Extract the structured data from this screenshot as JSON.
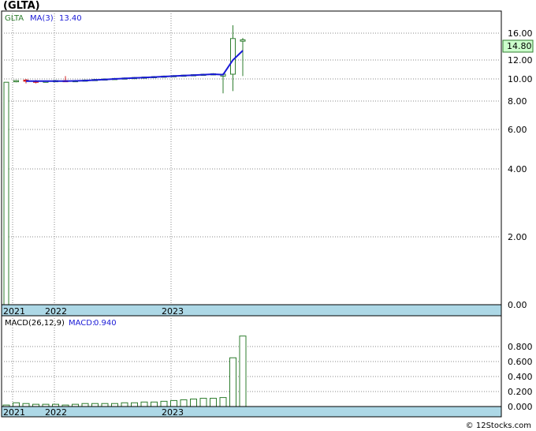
{
  "title": "(GLTA)",
  "footer": "© 12Stocks.com",
  "colors": {
    "up_candle": "#2e7d2e",
    "down_candle": "#d62020",
    "ma_line": "#1a1ad6",
    "date_band": "#add8e6",
    "grid": "#888888",
    "ticker_green": "#2e7d2e",
    "macd_blue": "#1a1ad6"
  },
  "chart_data": [
    {
      "type": "candlestick",
      "ticker_label": "GLTA",
      "ma_label": "MA(3)",
      "ma_value": "13.40",
      "last_price": "14.80",
      "scale": "log",
      "ylim": [
        0,
        18
      ],
      "y_ticks": [
        "16.00",
        "12.00",
        "10.00",
        "8.00",
        "6.00",
        "4.00",
        "2.00",
        "0.00"
      ],
      "y_tick_values": [
        16,
        12,
        10,
        8,
        6,
        4,
        2,
        0
      ],
      "x_ticks": [
        "2021",
        "2022",
        "2023"
      ],
      "grid": true,
      "candles": [
        {
          "open": 0.0,
          "high": 9.7,
          "low": 0.0,
          "close": 9.7,
          "dir": "up"
        },
        {
          "open": 9.8,
          "high": 9.9,
          "low": 9.7,
          "close": 9.85,
          "dir": "up"
        },
        {
          "open": 9.9,
          "high": 10.0,
          "low": 9.6,
          "close": 9.8,
          "dir": "down"
        },
        {
          "open": 9.8,
          "high": 9.9,
          "low": 9.6,
          "close": 9.75,
          "dir": "down"
        },
        {
          "open": 9.75,
          "high": 9.85,
          "low": 9.7,
          "close": 9.8,
          "dir": "up"
        },
        {
          "open": 9.8,
          "high": 9.9,
          "low": 9.75,
          "close": 9.85,
          "dir": "up"
        },
        {
          "open": 9.85,
          "high": 10.3,
          "low": 9.8,
          "close": 9.8,
          "dir": "down"
        },
        {
          "open": 9.8,
          "high": 9.9,
          "low": 9.75,
          "close": 9.85,
          "dir": "up"
        },
        {
          "open": 9.85,
          "high": 9.95,
          "low": 9.8,
          "close": 9.9,
          "dir": "up"
        },
        {
          "open": 9.9,
          "high": 10.0,
          "low": 9.85,
          "close": 9.95,
          "dir": "up"
        },
        {
          "open": 9.95,
          "high": 10.05,
          "low": 9.9,
          "close": 10.0,
          "dir": "up"
        },
        {
          "open": 10.0,
          "high": 10.1,
          "low": 9.95,
          "close": 10.05,
          "dir": "up"
        },
        {
          "open": 10.05,
          "high": 10.15,
          "low": 10.0,
          "close": 10.1,
          "dir": "up"
        },
        {
          "open": 10.1,
          "high": 10.2,
          "low": 10.05,
          "close": 10.15,
          "dir": "up"
        },
        {
          "open": 10.15,
          "high": 10.25,
          "low": 10.1,
          "close": 10.2,
          "dir": "up"
        },
        {
          "open": 10.2,
          "high": 10.3,
          "low": 10.15,
          "close": 10.25,
          "dir": "up"
        },
        {
          "open": 10.25,
          "high": 10.35,
          "low": 10.2,
          "close": 10.3,
          "dir": "up"
        },
        {
          "open": 10.3,
          "high": 10.4,
          "low": 10.25,
          "close": 10.35,
          "dir": "up"
        },
        {
          "open": 10.35,
          "high": 10.45,
          "low": 10.3,
          "close": 10.4,
          "dir": "up"
        },
        {
          "open": 10.4,
          "high": 10.5,
          "low": 10.35,
          "close": 10.45,
          "dir": "up"
        },
        {
          "open": 10.45,
          "high": 10.55,
          "low": 10.4,
          "close": 10.5,
          "dir": "up"
        },
        {
          "open": 10.5,
          "high": 10.6,
          "low": 10.4,
          "close": 10.55,
          "dir": "up"
        },
        {
          "open": 10.5,
          "high": 10.6,
          "low": 8.7,
          "close": 10.3,
          "dir": "up"
        },
        {
          "open": 10.5,
          "high": 17.0,
          "low": 8.9,
          "close": 15.2,
          "dir": "up"
        },
        {
          "open": 15.0,
          "high": 15.3,
          "low": 10.3,
          "close": 14.8,
          "dir": "up"
        }
      ],
      "ma3": [
        null,
        null,
        9.8,
        9.8,
        9.8,
        9.8,
        9.8,
        9.82,
        9.85,
        9.9,
        9.95,
        10.0,
        10.05,
        10.1,
        10.15,
        10.2,
        10.25,
        10.3,
        10.35,
        10.4,
        10.45,
        10.5,
        10.45,
        12.0,
        13.4
      ]
    },
    {
      "type": "bar",
      "label": "MACD(26,12,9)",
      "macd_label": "MACD:",
      "macd_value": "0.940",
      "ylim": [
        0,
        1.0
      ],
      "y_ticks": [
        "0.800",
        "0.600",
        "0.400",
        "0.200",
        "0.000"
      ],
      "y_tick_values": [
        0.8,
        0.6,
        0.4,
        0.2,
        0.0
      ],
      "x_ticks": [
        "2021",
        "2022",
        "2023"
      ],
      "values": [
        0.02,
        0.05,
        0.04,
        0.03,
        0.03,
        0.03,
        0.02,
        0.03,
        0.04,
        0.04,
        0.04,
        0.04,
        0.05,
        0.05,
        0.06,
        0.06,
        0.07,
        0.08,
        0.09,
        0.1,
        0.11,
        0.11,
        0.12,
        0.65,
        0.94
      ]
    }
  ]
}
